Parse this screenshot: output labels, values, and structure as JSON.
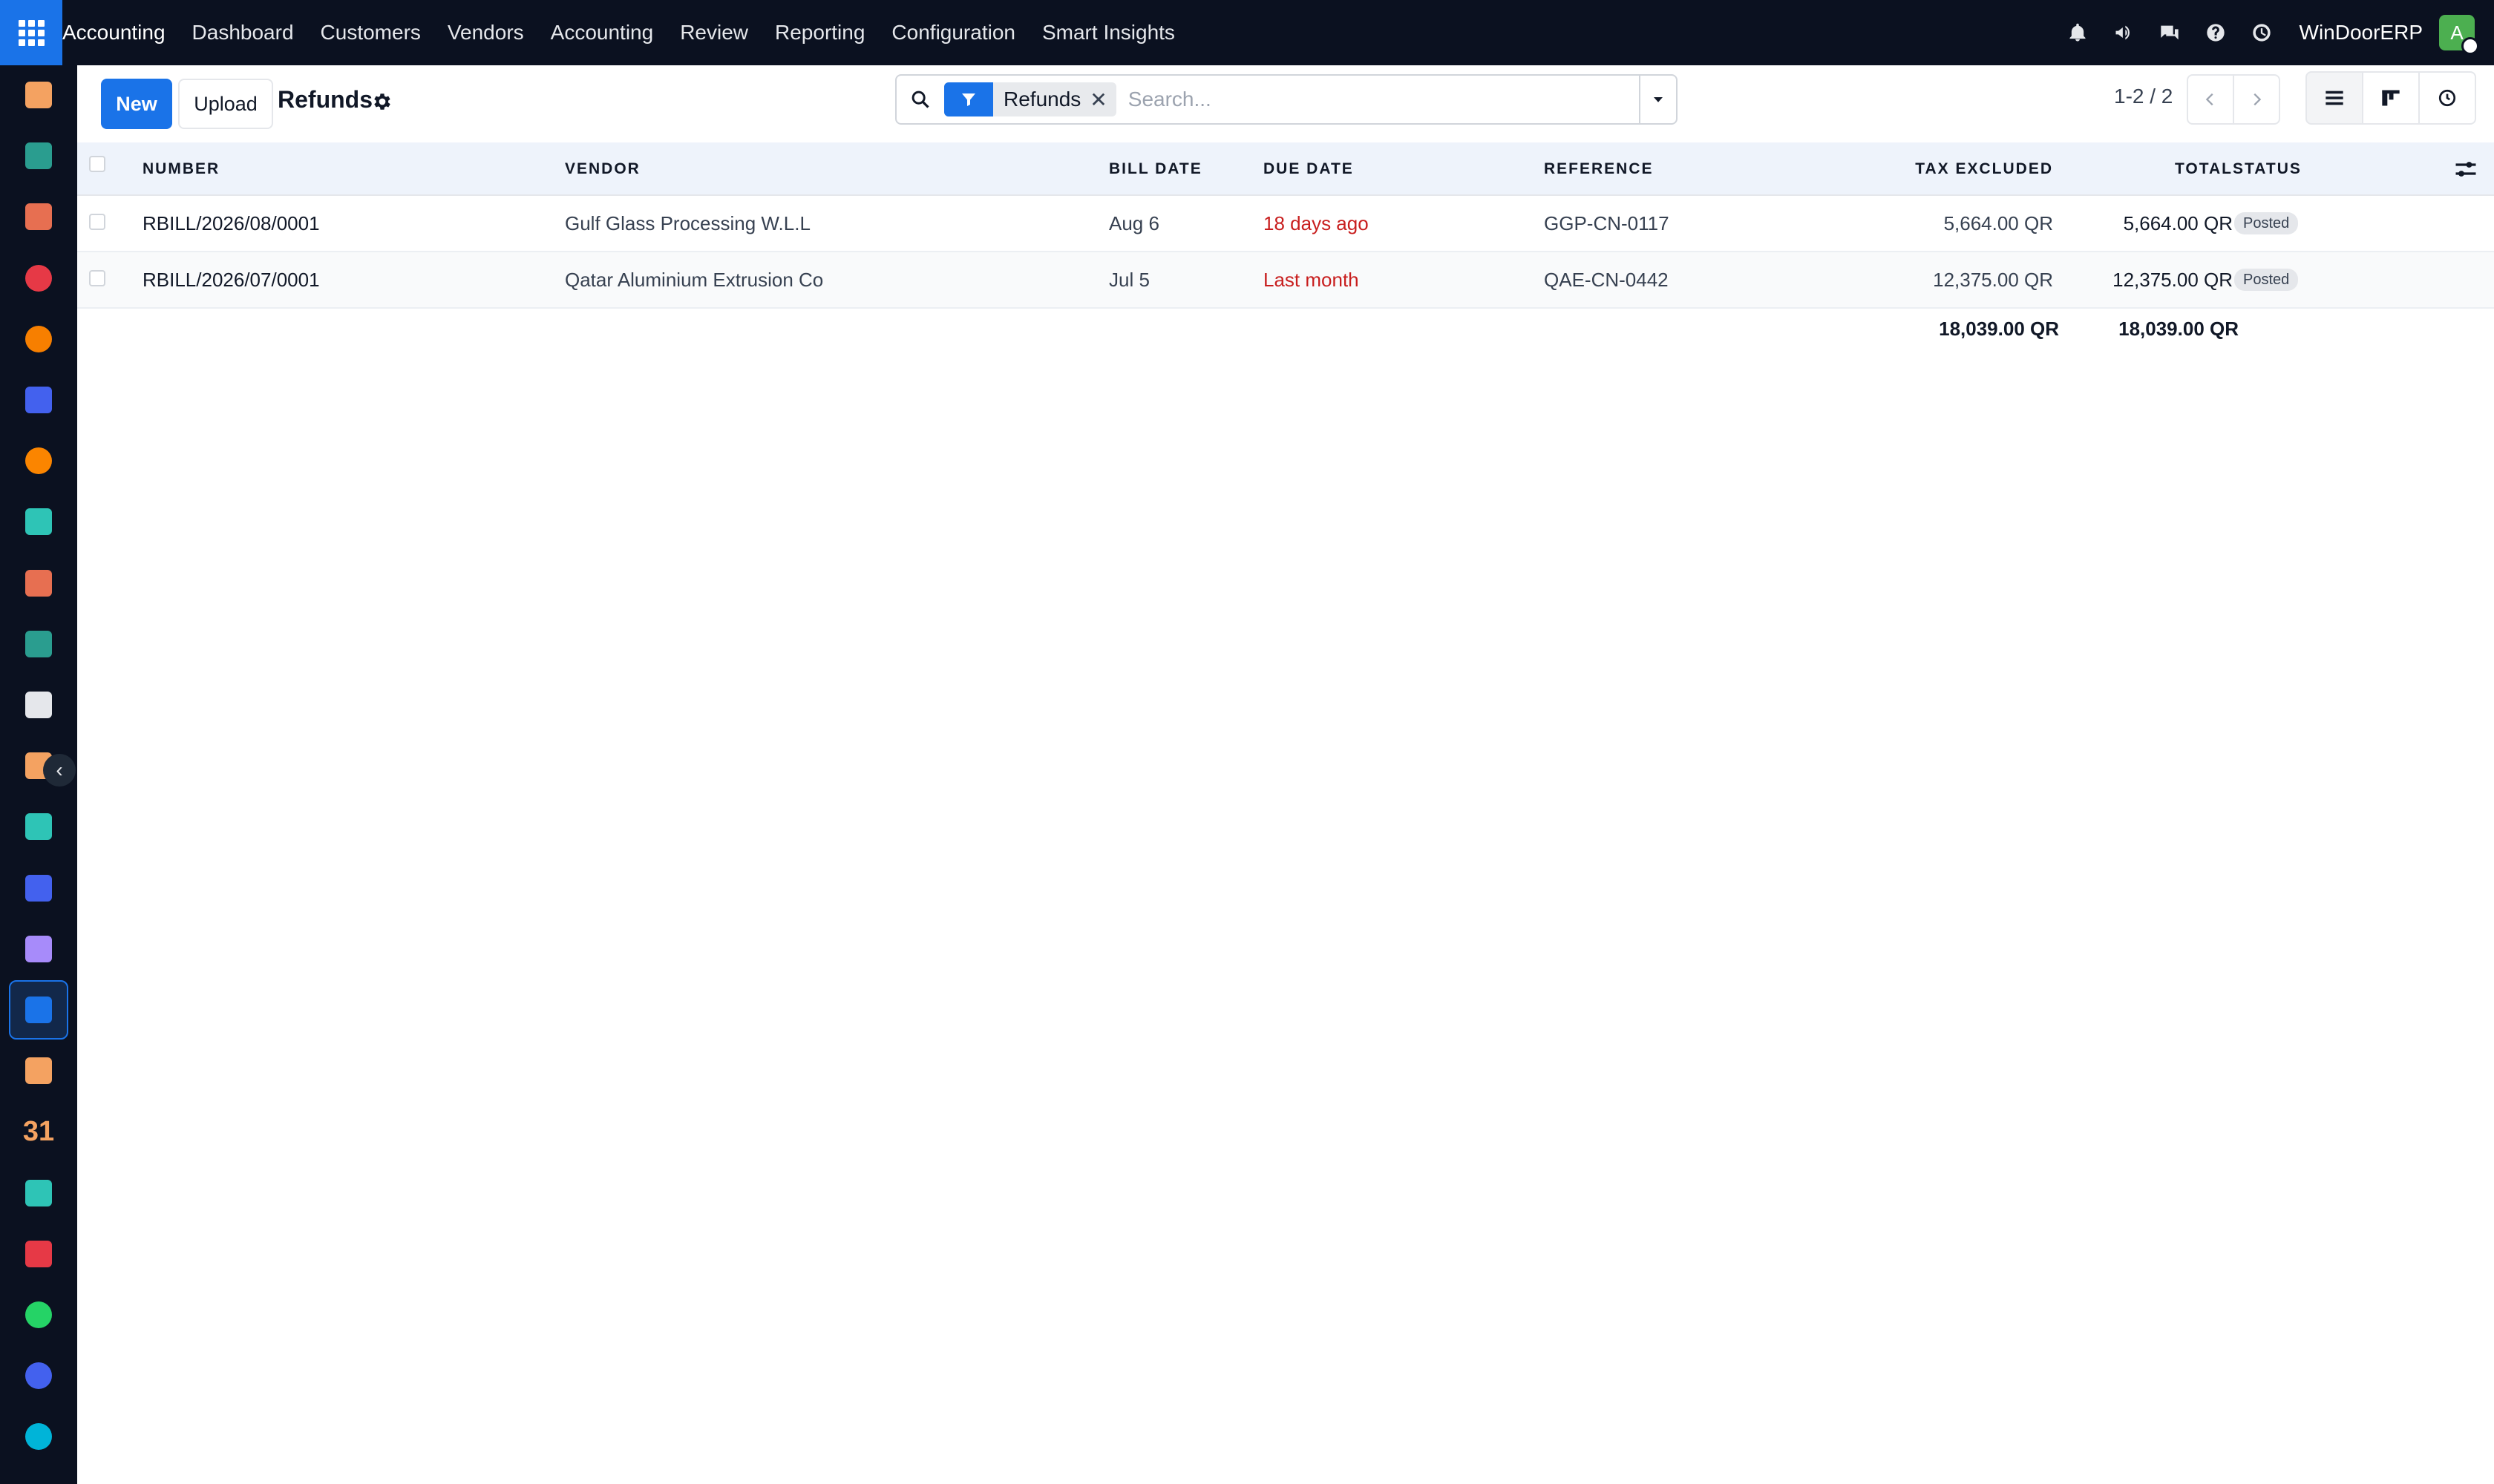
{
  "topbar": {
    "brand": "Accounting",
    "menu": [
      "Dashboard",
      "Customers",
      "Vendors",
      "Accounting",
      "Review",
      "Reporting",
      "Configuration",
      "Smart Insights"
    ],
    "company": "WinDoorERP",
    "avatar_initial": "A"
  },
  "control": {
    "new_label": "New",
    "upload_label": "Upload",
    "view_title": "Refunds",
    "facet_label": "Refunds",
    "facet_remove": "✕",
    "search_placeholder": "Search...",
    "pager_text": "1-2 / 2"
  },
  "table": {
    "headers": {
      "number": "NUMBER",
      "vendor": "VENDOR",
      "bill_date": "BILL DATE",
      "due_date": "DUE DATE",
      "reference": "REFERENCE",
      "tax_excluded": "TAX EXCLUDED",
      "total": "TOTAL",
      "status": "STATUS"
    },
    "rows": [
      {
        "number": "RBILL/2026/08/0001",
        "vendor": "Gulf Glass Processing W.L.L",
        "bill_date": "Aug 6",
        "due_date": "18 days ago",
        "reference": "GGP-CN-0117",
        "tax_excluded": "5,664.00 QR",
        "total": "5,664.00 QR",
        "status": "Posted"
      },
      {
        "number": "RBILL/2026/07/0001",
        "vendor": "Qatar Aluminium Extrusion Co",
        "bill_date": "Jul 5",
        "due_date": "Last month",
        "reference": "QAE-CN-0442",
        "tax_excluded": "12,375.00 QR",
        "total": "12,375.00 QR",
        "status": "Posted"
      }
    ],
    "totals": {
      "tax_excluded": "18,039.00 QR",
      "total": "18,039.00 QR"
    }
  },
  "sidebar": {
    "collapse_icon": "‹",
    "calendar_day": "31",
    "apps": [
      {
        "icon": "sparkle-app-icon",
        "color": "#f4a261"
      },
      {
        "icon": "contacts-app-icon",
        "color": "#2a9d8f"
      },
      {
        "icon": "reporting-app-icon",
        "color": "#e76f51"
      },
      {
        "icon": "pie-app-icon",
        "color": "#e63946"
      },
      {
        "icon": "chat-app-icon",
        "color": "#f77f00"
      },
      {
        "icon": "mail-app-icon",
        "color": "#4361ee"
      },
      {
        "icon": "discuss-app-icon",
        "color": "#fb8500"
      },
      {
        "icon": "tick-app-icon",
        "color": "#2ec4b6"
      },
      {
        "icon": "chart-app-icon",
        "color": "#e76f51"
      },
      {
        "icon": "employees-app-icon",
        "color": "#2a9d8f"
      },
      {
        "icon": "inventory-app-icon",
        "color": "#e5e7eb"
      },
      {
        "icon": "pen-app-icon",
        "color": "#f4a261"
      },
      {
        "icon": "check-app-icon",
        "color": "#2ec4b6"
      },
      {
        "icon": "knowledge-app-icon",
        "color": "#4361ee"
      },
      {
        "icon": "box-app-icon",
        "color": "#a78bfa"
      },
      {
        "icon": "accounting-app-icon",
        "color": "#1a73e8"
      },
      {
        "icon": "team-app-icon",
        "color": "#f4a261"
      },
      {
        "icon": "calendar-app-icon",
        "color": "#f4a261"
      },
      {
        "icon": "sign-app-icon",
        "color": "#2ec4b6"
      },
      {
        "icon": "dashboard-app-icon",
        "color": "#e63946"
      },
      {
        "icon": "whatsapp-app-icon",
        "color": "#25d366"
      },
      {
        "icon": "timer-app-icon",
        "color": "#4361ee"
      },
      {
        "icon": "wave-app-icon",
        "color": "#00b4d8"
      }
    ]
  }
}
